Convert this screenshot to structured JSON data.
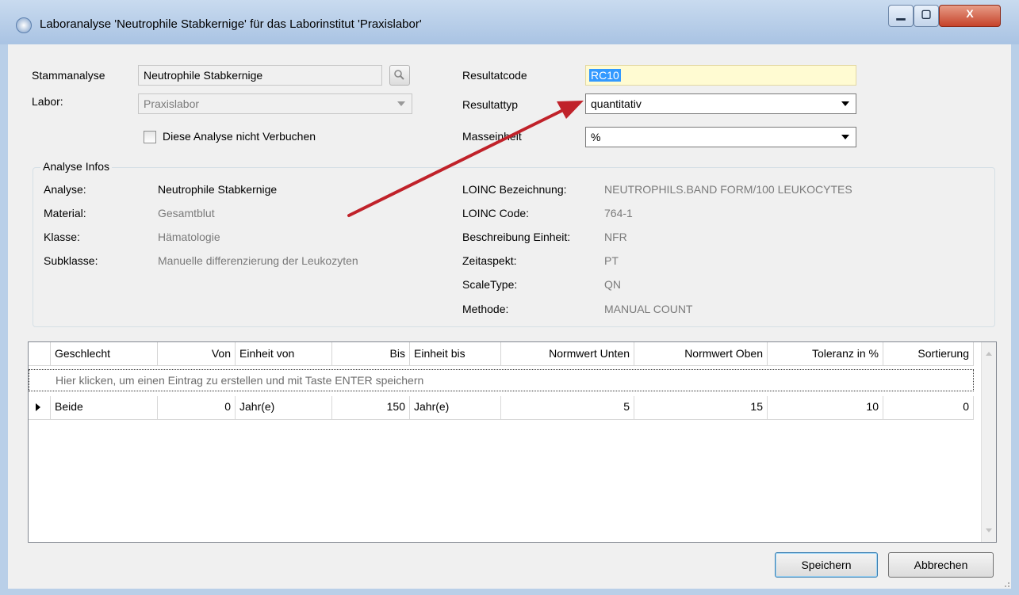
{
  "window": {
    "title": "Laboranalyse 'Neutrophile Stabkernige' für das Laborinstitut 'Praxislabor'",
    "minimize_glyph": "▁",
    "maximize_glyph": "▢",
    "close_glyph": "X"
  },
  "form": {
    "stammanalyse_label": "Stammanalyse",
    "stammanalyse_value": "Neutrophile Stabkernige",
    "labor_label": "Labor:",
    "labor_value": "Praxislabor",
    "nicht_verbuchen_label": "Diese Analyse nicht Verbuchen",
    "resultatcode_label": "Resultatcode",
    "resultatcode_value": "RC10",
    "resultattyp_label": "Resultattyp",
    "resultattyp_value": "quantitativ",
    "masseinheit_label": "Masseinheit",
    "masseinheit_value": "%"
  },
  "infos": {
    "title": "Analyse Infos",
    "left": [
      {
        "label": "Analyse:",
        "value": "Neutrophile Stabkernige"
      },
      {
        "label": "Material:",
        "value": "Gesamtblut"
      },
      {
        "label": "Klasse:",
        "value": "Hämatologie"
      },
      {
        "label": "Subklasse:",
        "value": "Manuelle differenzierung der Leukozyten"
      }
    ],
    "right": [
      {
        "label": "LOINC Bezeichnung:",
        "value": "NEUTROPHILS.BAND FORM/100 LEUKOCYTES"
      },
      {
        "label": "LOINC Code:",
        "value": "764-1"
      },
      {
        "label": "Beschreibung Einheit:",
        "value": "NFR"
      },
      {
        "label": "Zeitaspekt:",
        "value": "PT"
      },
      {
        "label": "ScaleType:",
        "value": "QN"
      },
      {
        "label": "Methode:",
        "value": "MANUAL COUNT"
      }
    ]
  },
  "grid": {
    "columns": [
      "Geschlecht",
      "Von",
      "Einheit von",
      "Bis",
      "Einheit bis",
      "Normwert Unten",
      "Normwert Oben",
      "Toleranz in %",
      "Sortierung"
    ],
    "new_row_hint": "Hier klicken, um einen Eintrag zu erstellen und mit Taste ENTER speichern",
    "rows": [
      [
        "Beide",
        "0",
        "Jahr(e)",
        "150",
        "Jahr(e)",
        "5",
        "15",
        "10",
        "0"
      ]
    ]
  },
  "buttons": {
    "save": "Speichern",
    "cancel": "Abbrechen"
  },
  "colors": {
    "annotation_arrow": "#c0222a",
    "resultatcode_bg": "#fffbd2",
    "selection": "#3399ff"
  }
}
